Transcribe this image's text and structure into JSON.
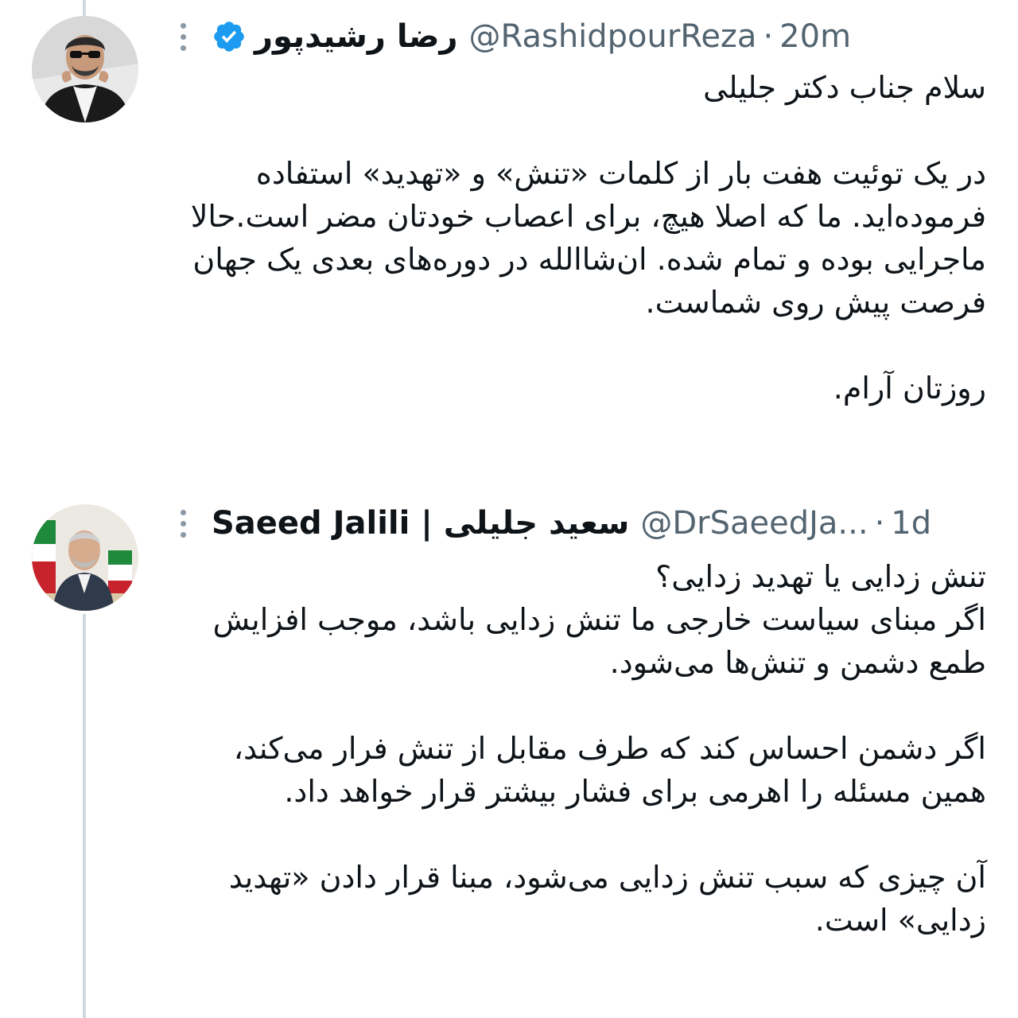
{
  "tweet": {
    "display_name": "رضا رشیدپور",
    "handle": "@RashidpourReza",
    "separator": "·",
    "time": "20m",
    "verified": true,
    "paragraphs": [
      "سلام جناب دکتر جلیلی",
      "در یک توئیت هفت بار از کلمات «تنش» و «تهدید» استفاده فرموده‌اید. ما که اصلا هیچ، برای اعصاب خودتان مضر است.حالا ماجرایی بوده و تمام شده. ان‌شاالله در دوره‌های بعدی یک جهان فرصت پیش روی شماست.",
      "روزتان آرام."
    ]
  },
  "quoted_tweet": {
    "display_name": "Saeed Jalili | سعید جلیلی",
    "handle": "@DrSaeedJa...",
    "separator": "·",
    "time": "1d",
    "paragraphs": [
      "تنش زدایی یا تهدید زدایی؟\nاگر مبنای سیاست خارجی ما تنش زدایی باشد، موجب افزایش طمع دشمن و تنش‌ها می‌شود.",
      "اگر دشمن احساس کند که طرف مقابل از تنش فرار می‌کند، همین مسئله را اهرمی برای فشار بیشتر قرار خواهد داد.",
      "آن چیزی که سبب تنش زدایی می‌شود، مبنا قرار دادن «تهدید زدایی» است."
    ]
  },
  "icons": {
    "verified": "verified-badge-icon",
    "more": "more-options-icon"
  },
  "colors": {
    "text_primary": "#0f1419",
    "text_secondary": "#536471",
    "verified_blue": "#1d9bf0",
    "thread_line": "#cfd9de"
  }
}
